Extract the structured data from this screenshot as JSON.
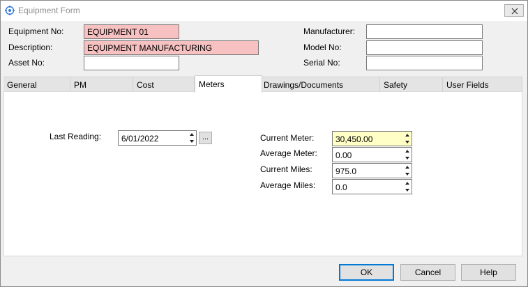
{
  "window": {
    "title": "Equipment Form"
  },
  "header": {
    "equipment_no": {
      "label": "Equipment No:",
      "value": "EQUIPMENT 01"
    },
    "description": {
      "label": "Description:",
      "value": "EQUIPMENT MANUFACTURING"
    },
    "asset_no": {
      "label": "Asset No:",
      "value": ""
    },
    "manufacturer": {
      "label": "Manufacturer:",
      "value": ""
    },
    "model_no": {
      "label": "Model No:",
      "value": ""
    },
    "serial_no": {
      "label": "Serial No:",
      "value": ""
    }
  },
  "tabs": [
    {
      "label": "General"
    },
    {
      "label": "PM"
    },
    {
      "label": "Cost"
    },
    {
      "label": "Meters"
    },
    {
      "label": "Drawings/Documents"
    },
    {
      "label": "Safety"
    },
    {
      "label": "User Fields"
    }
  ],
  "active_tab": "Meters",
  "meters": {
    "last_reading": {
      "label": "Last Reading:",
      "value": "6/01/2022",
      "button": "..."
    },
    "current_meter": {
      "label": "Current Meter:",
      "value": "30,450.00"
    },
    "average_meter": {
      "label": "Average Meter:",
      "value": "0.00"
    },
    "current_miles": {
      "label": "Current Miles:",
      "value": "975.0"
    },
    "average_miles": {
      "label": "Average Miles:",
      "value": "0.0"
    }
  },
  "buttons": {
    "ok": "OK",
    "cancel": "Cancel",
    "help": "Help"
  },
  "colors": {
    "required_field": "#f8c1c1",
    "focused_field": "#ffffc6",
    "default_button_border": "#0078d7"
  }
}
